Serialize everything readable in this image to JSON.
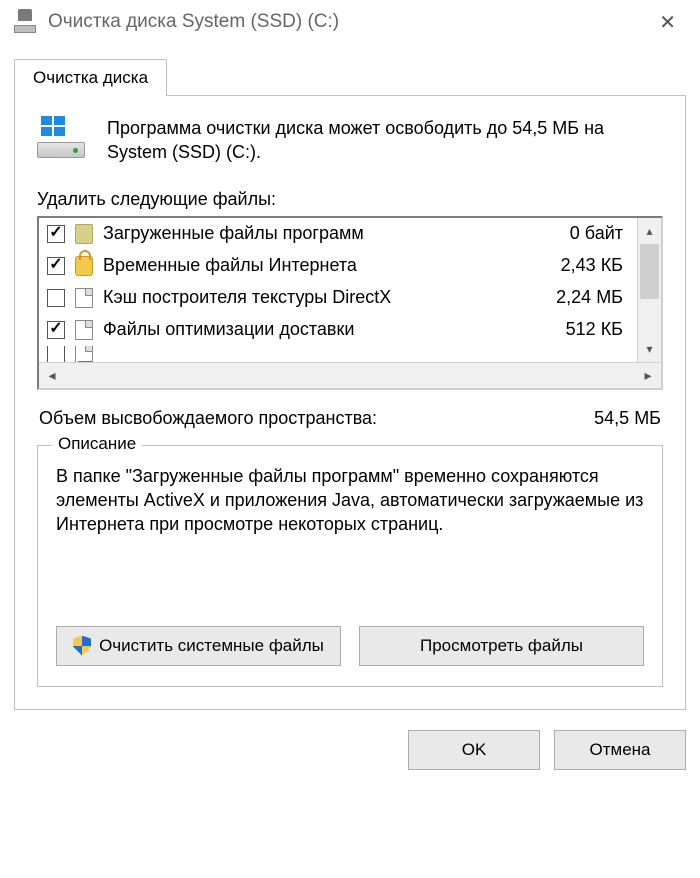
{
  "window": {
    "title": "Очистка диска System (SSD) (C:)"
  },
  "tab": {
    "label": "Очистка диска"
  },
  "intro": "Программа очистки диска может освободить до 54,5 МБ на System (SSD) (C:).",
  "list_label": "Удалить следующие файлы:",
  "files": [
    {
      "checked": true,
      "icon": "folder",
      "name": "Загруженные файлы программ",
      "size": "0 байт"
    },
    {
      "checked": true,
      "icon": "lock",
      "name": "Временные файлы Интернета",
      "size": "2,43 КБ"
    },
    {
      "checked": false,
      "icon": "file",
      "name": "Кэш построителя текстуры DirectX",
      "size": "2,24 МБ"
    },
    {
      "checked": true,
      "icon": "file",
      "name": "Файлы оптимизации доставки",
      "size": "512 КБ"
    }
  ],
  "total": {
    "label": "Объем высвобождаемого пространства:",
    "value": "54,5 МБ"
  },
  "description": {
    "legend": "Описание",
    "text": "В папке \"Загруженные файлы программ\" временно сохраняются элементы ActiveX и приложения Java, автоматически загружаемые из Интернета при просмотре некоторых страниц."
  },
  "buttons": {
    "clean_system": "Очистить системные файлы",
    "view_files": "Просмотреть файлы",
    "ok": "OK",
    "cancel": "Отмена"
  }
}
